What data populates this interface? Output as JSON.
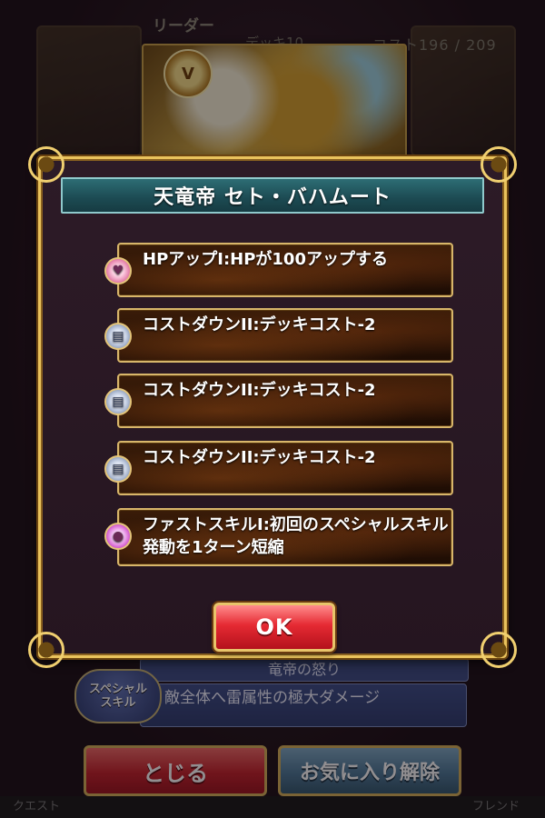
{
  "background": {
    "header_label": "リーダー",
    "deck_label": "デッキ10",
    "deck_stat": "コスト196 / 209",
    "card_emblem": "V",
    "special_skill": {
      "badge_line1": "スペシャル",
      "badge_line2": "スキル",
      "name": "竜帝の怒り",
      "description": "敵全体へ雷属性の極大ダメージ"
    },
    "close_button": "とじる",
    "favorite_button": "お気に入り解除",
    "bottom_nav": [
      "クエスト",
      "",
      "",
      "",
      "",
      "フレンド"
    ]
  },
  "modal": {
    "title": "天竜帝 セト・バハムート",
    "abilities": [
      {
        "icon": "hp-up-icon",
        "text": "HPアップI:HPが100アップする"
      },
      {
        "icon": "cost-down-icon",
        "text": "コストダウンII:デッキコスト-2"
      },
      {
        "icon": "cost-down-icon",
        "text": "コストダウンII:デッキコスト-2"
      },
      {
        "icon": "cost-down-icon",
        "text": "コストダウンII:デッキコスト-2"
      },
      {
        "icon": "first-skill-icon",
        "text": "ファストスキルI:初回のスペシャルスキル発動を1ターン短縮"
      }
    ],
    "ok_label": "OK"
  },
  "colors": {
    "frame_gold": "#e9c25c",
    "title_teal": "#1c4a52",
    "ok_red": "#e62a33"
  }
}
